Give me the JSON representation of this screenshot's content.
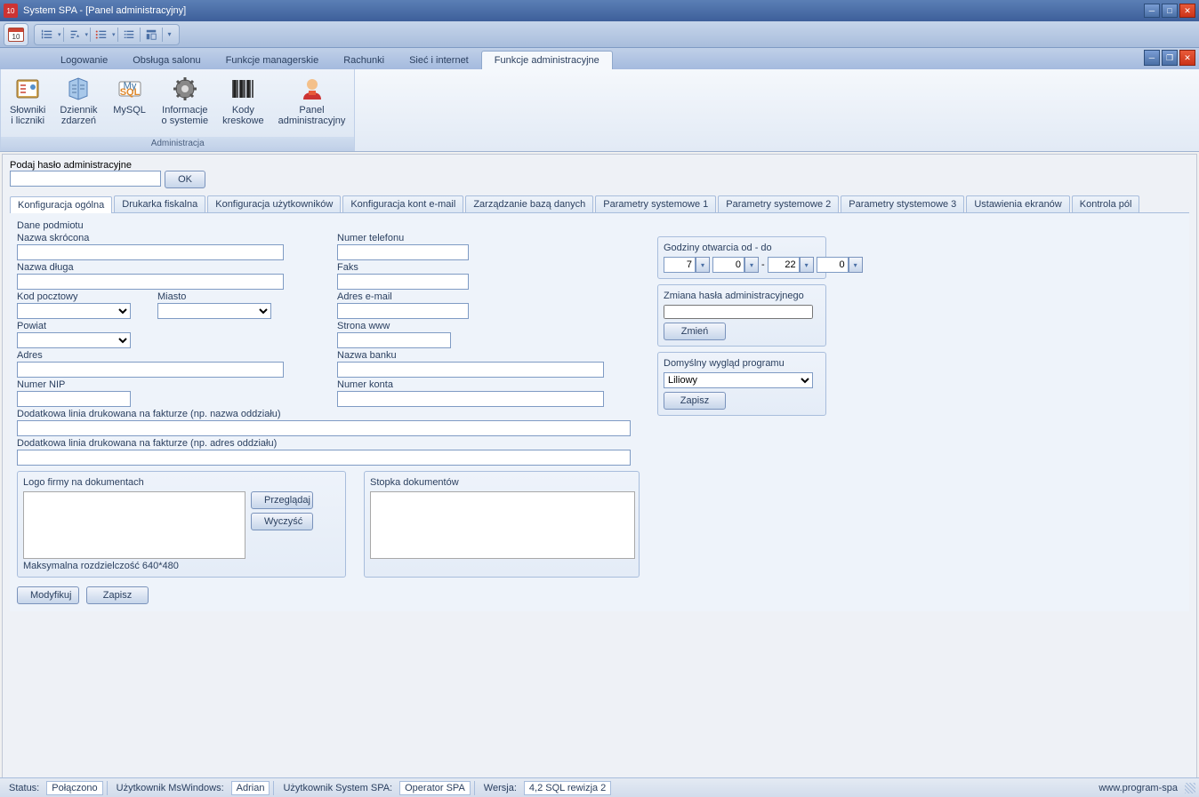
{
  "window": {
    "title": "System SPA  - [Panel administracyjny]"
  },
  "main_tabs": [
    "Logowanie",
    "Obsługa salonu",
    "Funkcje managerskie",
    "Rachunki",
    "Sieć i internet",
    "Funkcje administracyjne"
  ],
  "main_tab_active": 5,
  "ribbon": {
    "group_label": "Administracja",
    "buttons": [
      {
        "label": "Słowniki\ni liczniki",
        "icon": "dictionary"
      },
      {
        "label": "Dziennik\nzdarzeń",
        "icon": "log"
      },
      {
        "label": "MySQL",
        "icon": "mysql"
      },
      {
        "label": "Informacje\no systemie",
        "icon": "sysinfo"
      },
      {
        "label": "Kody\nkreskowe",
        "icon": "barcode"
      },
      {
        "label": "Panel\nadministracyjny",
        "icon": "admin"
      }
    ]
  },
  "password_section": {
    "label": "Podaj hasło administracyjne",
    "ok": "OK"
  },
  "sub_tabs": [
    "Konfiguracja ogólna",
    "Drukarka fiskalna",
    "Konfiguracja użytkowników",
    "Konfiguracja kont e-mail",
    "Zarządzanie bazą danych",
    "Parametry systemowe 1",
    "Parametry systemowe 2",
    "Parametry stystemowe 3",
    "Ustawienia ekranów",
    "Kontrola pól"
  ],
  "sub_tab_active": 0,
  "form": {
    "dane_podmiotu": "Dane podmiotu",
    "nazwa_skrocona": "Nazwa skrócona",
    "nazwa_dluga": "Nazwa długa",
    "kod_pocztowy": "Kod pocztowy",
    "miasto": "Miasto",
    "powiat": "Powiat",
    "adres": "Adres",
    "numer_nip": "Numer NIP",
    "dod1": "Dodatkowa linia drukowana na fakturze (np. nazwa oddziału)",
    "dod2": "Dodatkowa linia drukowana na fakturze (np. adres oddziału)",
    "numer_telefonu": "Numer telefonu",
    "faks": "Faks",
    "adres_email": "Adres e-mail",
    "strona_www": "Strona www",
    "nazwa_banku": "Nazwa banku",
    "numer_konta": "Numer konta",
    "godziny_label": "Godziny otwarcia od - do",
    "godz_od_h": "7",
    "godz_od_m": "0",
    "godz_do_h": "22",
    "godz_do_m": "0",
    "zmiana_hasla": "Zmiana hasła administracyjnego",
    "zmien": "Zmień",
    "wyglad_label": "Domyślny wygląd programu",
    "wyglad_value": "Liliowy",
    "zapisz": "Zapisz",
    "logo_label": "Logo firmy na dokumentach",
    "przegladaj": "Przeglądaj",
    "wyczysc": "Wyczyść",
    "max_res": "Maksymalna rozdzielczość 640*480",
    "stopka_label": "Stopka dokumentów",
    "modyfikuj": "Modyfikuj"
  },
  "statusbar": {
    "status_lbl": "Status:",
    "status_val": "Połączono",
    "winuser_lbl": "Użytkownik MsWindows:",
    "winuser_val": "Adrian",
    "spauser_lbl": "Użytkownik System SPA:",
    "spauser_val": "Operator SPA",
    "ver_lbl": "Wersja:",
    "ver_val": "4,2 SQL rewizja 2",
    "url": "www.program-spa"
  }
}
